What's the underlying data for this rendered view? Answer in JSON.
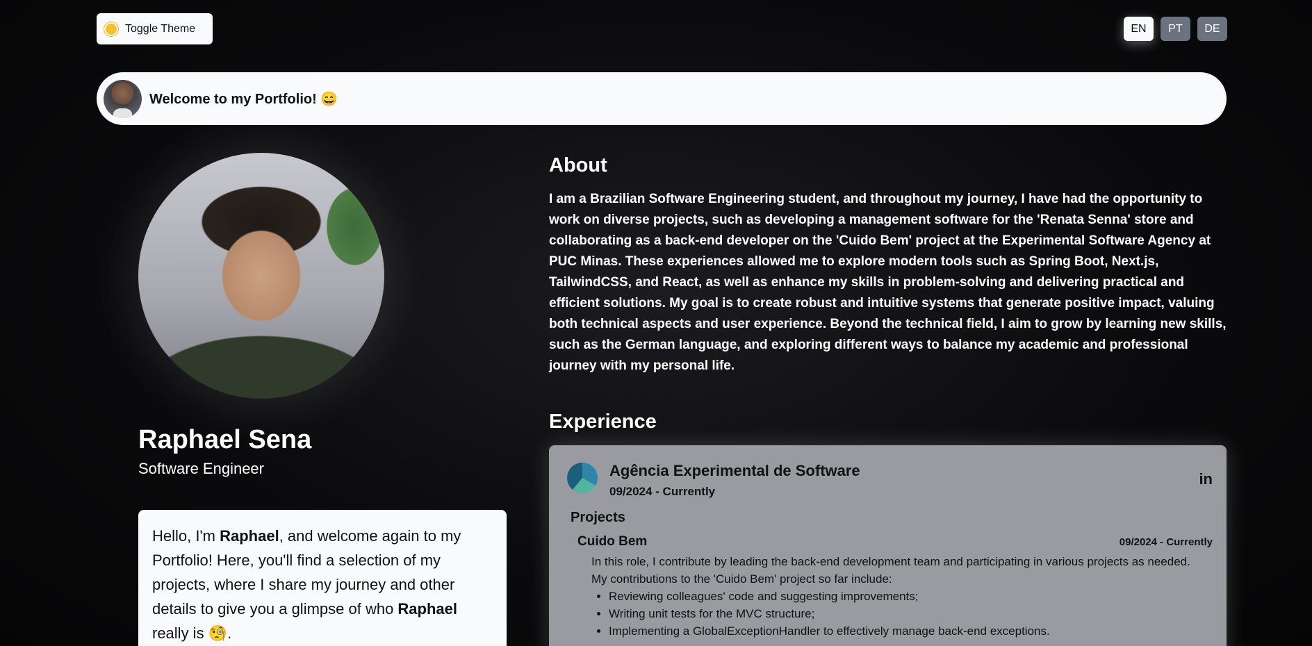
{
  "header": {
    "toggle_theme_label": "Toggle Theme",
    "languages": [
      {
        "code": "EN",
        "active": true
      },
      {
        "code": "PT",
        "active": false
      },
      {
        "code": "DE",
        "active": false
      }
    ]
  },
  "welcome": {
    "text": "Welcome to my Portfolio! 😄"
  },
  "profile": {
    "name": "Raphael Sena",
    "role": "Software Engineer",
    "intro_prefix": "Hello, I'm ",
    "intro_name": "Raphael",
    "intro_middle": ", and welcome again to my Portfolio! Here, you'll find a selection of my projects, where I share my journey and other details to give you a glimpse of who ",
    "intro_name_2": "Raphael",
    "intro_suffix": " really is 🧐."
  },
  "about": {
    "title": "About",
    "text": "I am a Brazilian Software Engineering student, and throughout my journey, I have had the opportunity to work on diverse projects, such as developing a management software for the 'Renata Senna' store and collaborating as a back-end developer on the 'Cuido Bem' project at the Experimental Software Agency at PUC Minas. These experiences allowed me to explore modern tools such as Spring Boot, Next.js, TailwindCSS, and React, as well as enhance my skills in problem-solving and delivering practical and efficient solutions. My goal is to create robust and intuitive systems that generate positive impact, valuing both technical aspects and user experience. Beyond the technical field, I aim to grow by learning new skills, such as the German language, and exploring different ways to balance my academic and professional journey with my personal life."
  },
  "experience": {
    "title": "Experience",
    "company": "Agência Experimental de Software",
    "period": "09/2024 - Currently",
    "linkedin_label": "in",
    "projects_label": "Projects",
    "project": {
      "name": "Cuido Bem",
      "period": "09/2024 - Currently",
      "description": "In this role, I contribute by leading the back-end development team and participating in various projects as needed. My contributions to the 'Cuido Bem' project so far include:",
      "items": [
        "Reviewing colleagues' code and suggesting improvements;",
        "Writing unit tests for the MVC structure;",
        "Implementing a GlobalExceptionHandler to effectively manage back-end exceptions."
      ]
    }
  }
}
